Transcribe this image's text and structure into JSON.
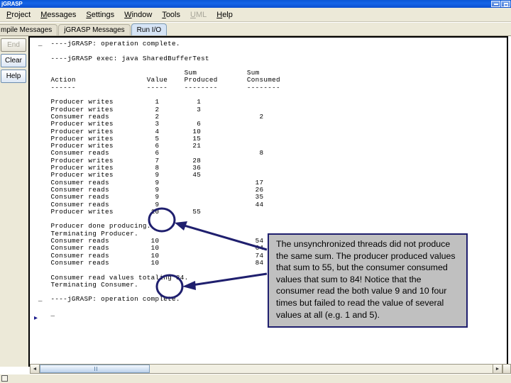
{
  "window": {
    "title": "jGRASP",
    "controls": [
      {
        "name": "minimize",
        "glyph": "_"
      },
      {
        "name": "maximize",
        "glyph": "□"
      }
    ]
  },
  "menubar": {
    "items": [
      {
        "label": "Project",
        "mnemonic": "P",
        "disabled": false
      },
      {
        "label": "Messages",
        "mnemonic": "M",
        "disabled": false
      },
      {
        "label": "Settings",
        "mnemonic": "S",
        "disabled": false
      },
      {
        "label": "Window",
        "mnemonic": "W",
        "disabled": false
      },
      {
        "label": "Tools",
        "mnemonic": "T",
        "disabled": false
      },
      {
        "label": "UML",
        "mnemonic": "U",
        "disabled": true
      },
      {
        "label": "Help",
        "mnemonic": "H",
        "disabled": false
      }
    ]
  },
  "tabs": [
    {
      "label": "mpile Messages",
      "selected": false
    },
    {
      "label": "jGRASP Messages",
      "selected": false
    },
    {
      "label": "Run I/O",
      "selected": true
    }
  ],
  "side_buttons": [
    {
      "label": "End",
      "disabled": true
    },
    {
      "label": "Clear",
      "disabled": false
    },
    {
      "label": "Help",
      "disabled": false
    }
  ],
  "console": {
    "prompt_glyph": "▸",
    "text": " _  ----jGRASP: operation complete.\n\n    ----jGRASP exec: java SharedBufferTest\n\n                                    Sum            Sum\n    Action                 Value    Produced       Consumed\n    ------                 -----    --------       --------\n\n    Producer writes          1         1\n    Producer writes          2         3\n    Consumer reads           2                        2\n    Producer writes          3         6\n    Producer writes          4        10\n    Producer writes          5        15\n    Producer writes          6        21\n    Consumer reads           6                        8\n    Producer writes          7        28\n    Producer writes          8        36\n    Producer writes          9        45\n    Consumer reads           9                       17\n    Consumer reads           9                       26\n    Consumer reads           9                       35\n    Consumer reads           9                       44\n    Producer writes         10        55\n\n    Producer done producing.\n    Terminating Producer.\n    Consumer reads          10                       54\n    Consumer reads          10                       64\n    Consumer reads          10                       74\n    Consumer reads          10                       84\n\n    Consumer read values totaling 84.\n    Terminating Consumer.\n\n _  ----jGRASP: operation complete.\n\n    _"
  },
  "annotation": {
    "callout_text": "The unsynchronized threads did not produce the same sum.  The producer produced values that sum to 55, but the consumer consumed values that sum to 84!  Notice that the consumer read the both value 9 and 10 four times but failed to read the value of several values at all (e.g. 1 and 5).",
    "circled_values": [
      "55",
      "84."
    ],
    "colors": {
      "annotation_stroke": "#1f1f6e",
      "callout_fill": "#c0c0c0"
    }
  },
  "scrollbar": {
    "left_arrow": "◄",
    "right_arrow": "►"
  }
}
